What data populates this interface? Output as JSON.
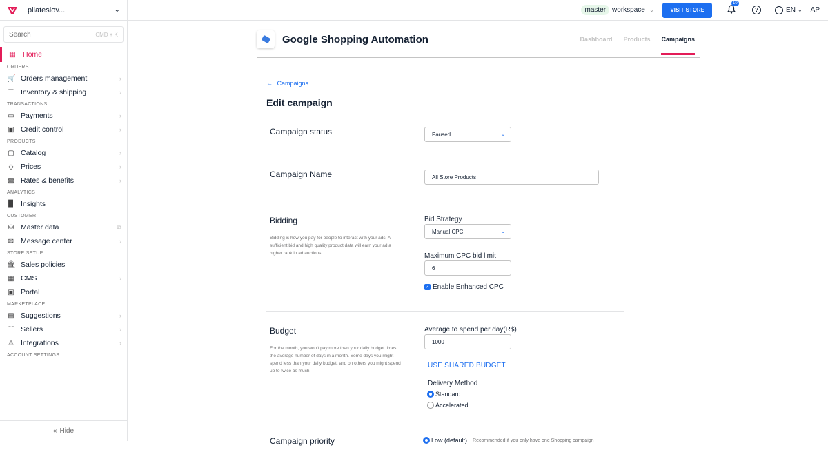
{
  "sidebar": {
    "account_name": "pilateslov...",
    "search_placeholder": "Search",
    "search_shortcut": "CMD + K",
    "home_label": "Home",
    "sections": {
      "orders": "ORDERS",
      "transactions": "TRANSACTIONS",
      "products": "PRODUCTS",
      "analytics": "ANALYTICS",
      "customer": "CUSTOMER",
      "store_setup": "STORE SETUP",
      "marketplace": "MARKETPLACE",
      "account_settings": "ACCOUNT SETTINGS"
    },
    "items": {
      "orders_management": "Orders management",
      "inventory_shipping": "Inventory & shipping",
      "payments": "Payments",
      "credit_control": "Credit control",
      "catalog": "Catalog",
      "prices": "Prices",
      "rates_benefits": "Rates & benefits",
      "insights": "Insights",
      "master_data": "Master data",
      "message_center": "Message center",
      "sales_policies": "Sales policies",
      "cms": "CMS",
      "portal": "Portal",
      "suggestions": "Suggestions",
      "sellers": "Sellers",
      "integrations": "Integrations"
    },
    "hide_label": "Hide"
  },
  "topbar": {
    "workspace_name": "master",
    "workspace_label": "workspace",
    "visit_store": "VISIT STORE",
    "notification_count": "10",
    "help": "?",
    "language": "EN",
    "user_initials": "AP"
  },
  "app": {
    "title": "Google Shopping Automation",
    "tabs": [
      "Dashboard",
      "Products",
      "Campaigns"
    ],
    "active_tab": "Campaigns"
  },
  "page": {
    "back_link": "Campaigns",
    "title": "Edit campaign"
  },
  "form": {
    "status": {
      "label": "Campaign status",
      "value": "Paused"
    },
    "name": {
      "label": "Campaign Name",
      "value": "All Store Products"
    },
    "bidding": {
      "label": "Bidding",
      "description": "Bidding is how you pay for people to interact with your ads. A sufficient bid and high quality product data will earn your ad a higher rank in ad auctions.",
      "strategy_label": "Bid Strategy",
      "strategy_value": "Manual CPC",
      "max_cpc_label": "Maximum CPC bid limit",
      "max_cpc_value": "6",
      "enhanced_cpc_label": "Enable Enhanced CPC",
      "enhanced_cpc_checked": true
    },
    "budget": {
      "label": "Budget",
      "description": "For the month, you won't pay more than your daily budget times the average number of days in a month. Some days you might spend less than your daily budget, and on others you might spend up to twice as much.",
      "avg_label": "Average to spend per day(R$)",
      "avg_value": "1000",
      "shared_budget": "USE SHARED BUDGET",
      "delivery_label": "Delivery Method",
      "delivery_options": [
        "Standard",
        "Accelerated"
      ],
      "delivery_selected": "Standard"
    },
    "priority": {
      "label": "Campaign priority",
      "option": "Low (default)",
      "note": "Recommended if you only have one Shopping campaign"
    }
  },
  "colors": {
    "accent": "#e31c58",
    "primary": "#1d6ff0"
  }
}
